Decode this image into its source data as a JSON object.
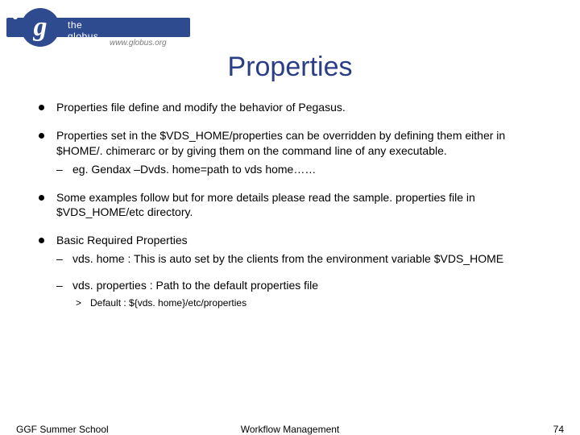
{
  "logo": {
    "letter": "g",
    "band": "the globus alliance",
    "url": "www.globus.org"
  },
  "title": "Properties",
  "bullets": {
    "b1": "Properties file define and modify the behavior of Pegasus.",
    "b2": "Properties set in the $VDS_HOME/properties can be overridden by defining them either in $HOME/. chimerarc or by giving them on the command line of any executable.",
    "b2_sub1": "eg. Gendax –Dvds. home=path to vds home……",
    "b3": "Some examples follow but for more details please read the sample. properties file in $VDS_HOME/etc directory.",
    "b4": "Basic Required Properties",
    "b4_sub1": "vds. home  : This is auto set by the clients from the environment variable $VDS_HOME",
    "b4_sub2": "vds. properties : Path to the default properties file",
    "b4_sub2_sub1": "Default  : ${vds. home}/etc/properties"
  },
  "footer": {
    "left": "GGF Summer School",
    "mid": "Workflow Management",
    "right": "74"
  }
}
